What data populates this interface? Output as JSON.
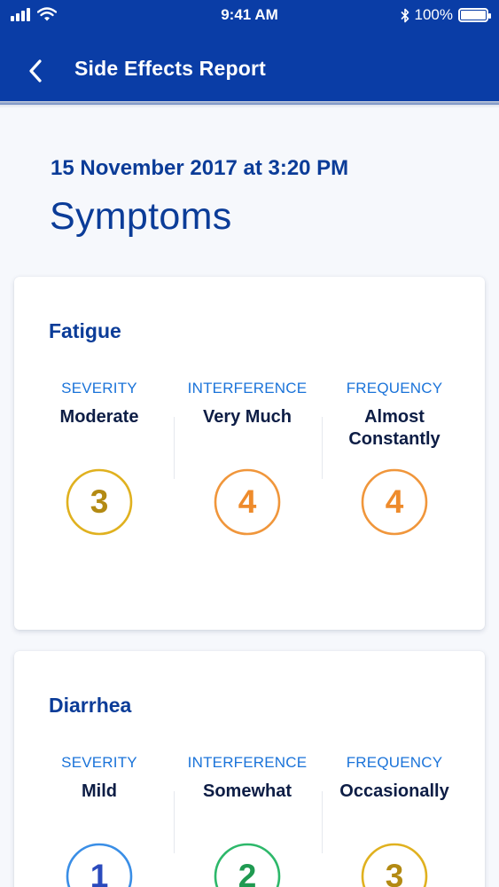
{
  "status_bar": {
    "time": "9:41 AM",
    "battery": "100%"
  },
  "nav": {
    "title": "Side Effects Report"
  },
  "date": "15 November 2017 at 3:20 PM",
  "heading": "Symptoms",
  "cards": [
    {
      "title": "Fatigue",
      "metrics": [
        {
          "label": "SEVERITY",
          "value": "Moderate",
          "score": "3",
          "color": "#e0b11f",
          "num_color": "#b38a13"
        },
        {
          "label": "INTERFERENCE",
          "value": "Very Much",
          "score": "4",
          "color": "#f0963b",
          "num_color": "#ee8b2c"
        },
        {
          "label": "FREQUENCY",
          "value": "Almost Constantly",
          "score": "4",
          "color": "#f0963b",
          "num_color": "#ee8b2c"
        }
      ]
    },
    {
      "title": "Diarrhea",
      "metrics": [
        {
          "label": "SEVERITY",
          "value": "Mild",
          "score": "1",
          "color": "#3a8ee6",
          "num_color": "#2b4bbd"
        },
        {
          "label": "INTERFERENCE",
          "value": "Somewhat",
          "score": "2",
          "color": "#2db86a",
          "num_color": "#1f9a51"
        },
        {
          "label": "FREQUENCY",
          "value": "Occasionally",
          "score": "3",
          "color": "#e0b11f",
          "num_color": "#b38a13"
        }
      ]
    }
  ],
  "icons": {
    "back": "chevron-left-icon",
    "signal": "signal-icon",
    "wifi": "wifi-icon",
    "bluetooth": "bluetooth-icon",
    "battery": "battery-icon"
  }
}
